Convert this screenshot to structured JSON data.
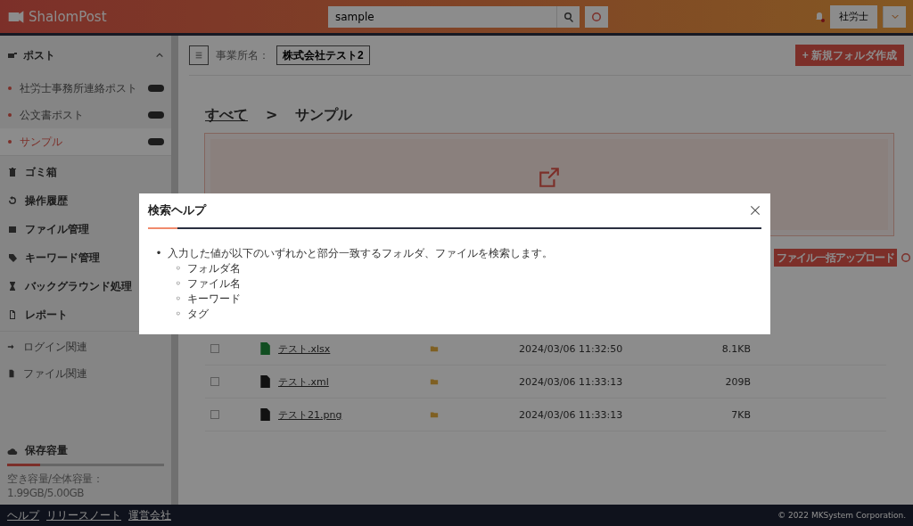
{
  "header": {
    "logo": "ShalomPost",
    "search": {
      "value": "sample"
    },
    "user": "社労士"
  },
  "sidebar": {
    "section": {
      "label": "ポスト",
      "expanded": true,
      "items": [
        {
          "label": "社労士事務所連絡ポスト",
          "selected": false
        },
        {
          "label": "公文書ポスト",
          "selected": false
        },
        {
          "label": "サンプル",
          "selected": true
        }
      ]
    },
    "menu": [
      {
        "label": "ゴミ箱",
        "kind": "trash"
      },
      {
        "label": "操作履歴",
        "kind": "history"
      },
      {
        "label": "ファイル管理",
        "kind": "box"
      },
      {
        "label": "キーワード管理",
        "kind": "tag"
      },
      {
        "label": "バックグラウンド処理",
        "kind": "hourglass"
      },
      {
        "label": "レポート",
        "kind": "report"
      }
    ],
    "logs": [
      {
        "label": "ログイン関連",
        "kind": "login"
      },
      {
        "label": "ファイル関連",
        "kind": "file"
      }
    ],
    "storage": {
      "label": "保存容量",
      "level": 0.21,
      "reading": "空き容量/全体容量：1.99GB/5.00GB"
    }
  },
  "toolbar": {
    "office_label": "事業所名：",
    "office": "株式会社テスト2",
    "new_folder": "+ 新規フォルダ作成"
  },
  "breadcrumb": [
    "すべて",
    ">",
    "サンプル"
  ],
  "upload_button": "ファイル一括アップロード",
  "files": [
    {
      "name": "テスト.xlsx",
      "kind": "excel",
      "checked": false,
      "date": "2024/03/06 11:32:50",
      "size": "8.1KB"
    },
    {
      "name": "テスト.xml",
      "kind": "code",
      "checked": false,
      "date": "2024/03/06 11:33:13",
      "size": "209B"
    },
    {
      "name": "テスト21.png",
      "kind": "image",
      "checked": false,
      "date": "2024/03/06 11:33:13",
      "size": "7KB"
    }
  ],
  "footer": {
    "links": [
      "ヘルプ",
      "リリースノート",
      "運営会社"
    ],
    "copyright": "© 2022 MKSystem Corporation."
  },
  "dialog": {
    "title": "検索ヘルプ",
    "marker": "•",
    "text": "入力した値が以下のいずれかと部分一致するフォルダ、ファイルを検索します。",
    "items": [
      {
        "marker": "◦",
        "label": "フォルダ名"
      },
      {
        "marker": "◦",
        "label": "ファイル名"
      },
      {
        "marker": "◦",
        "label": "キーワード"
      },
      {
        "marker": "◦",
        "label": "タグ"
      }
    ]
  }
}
